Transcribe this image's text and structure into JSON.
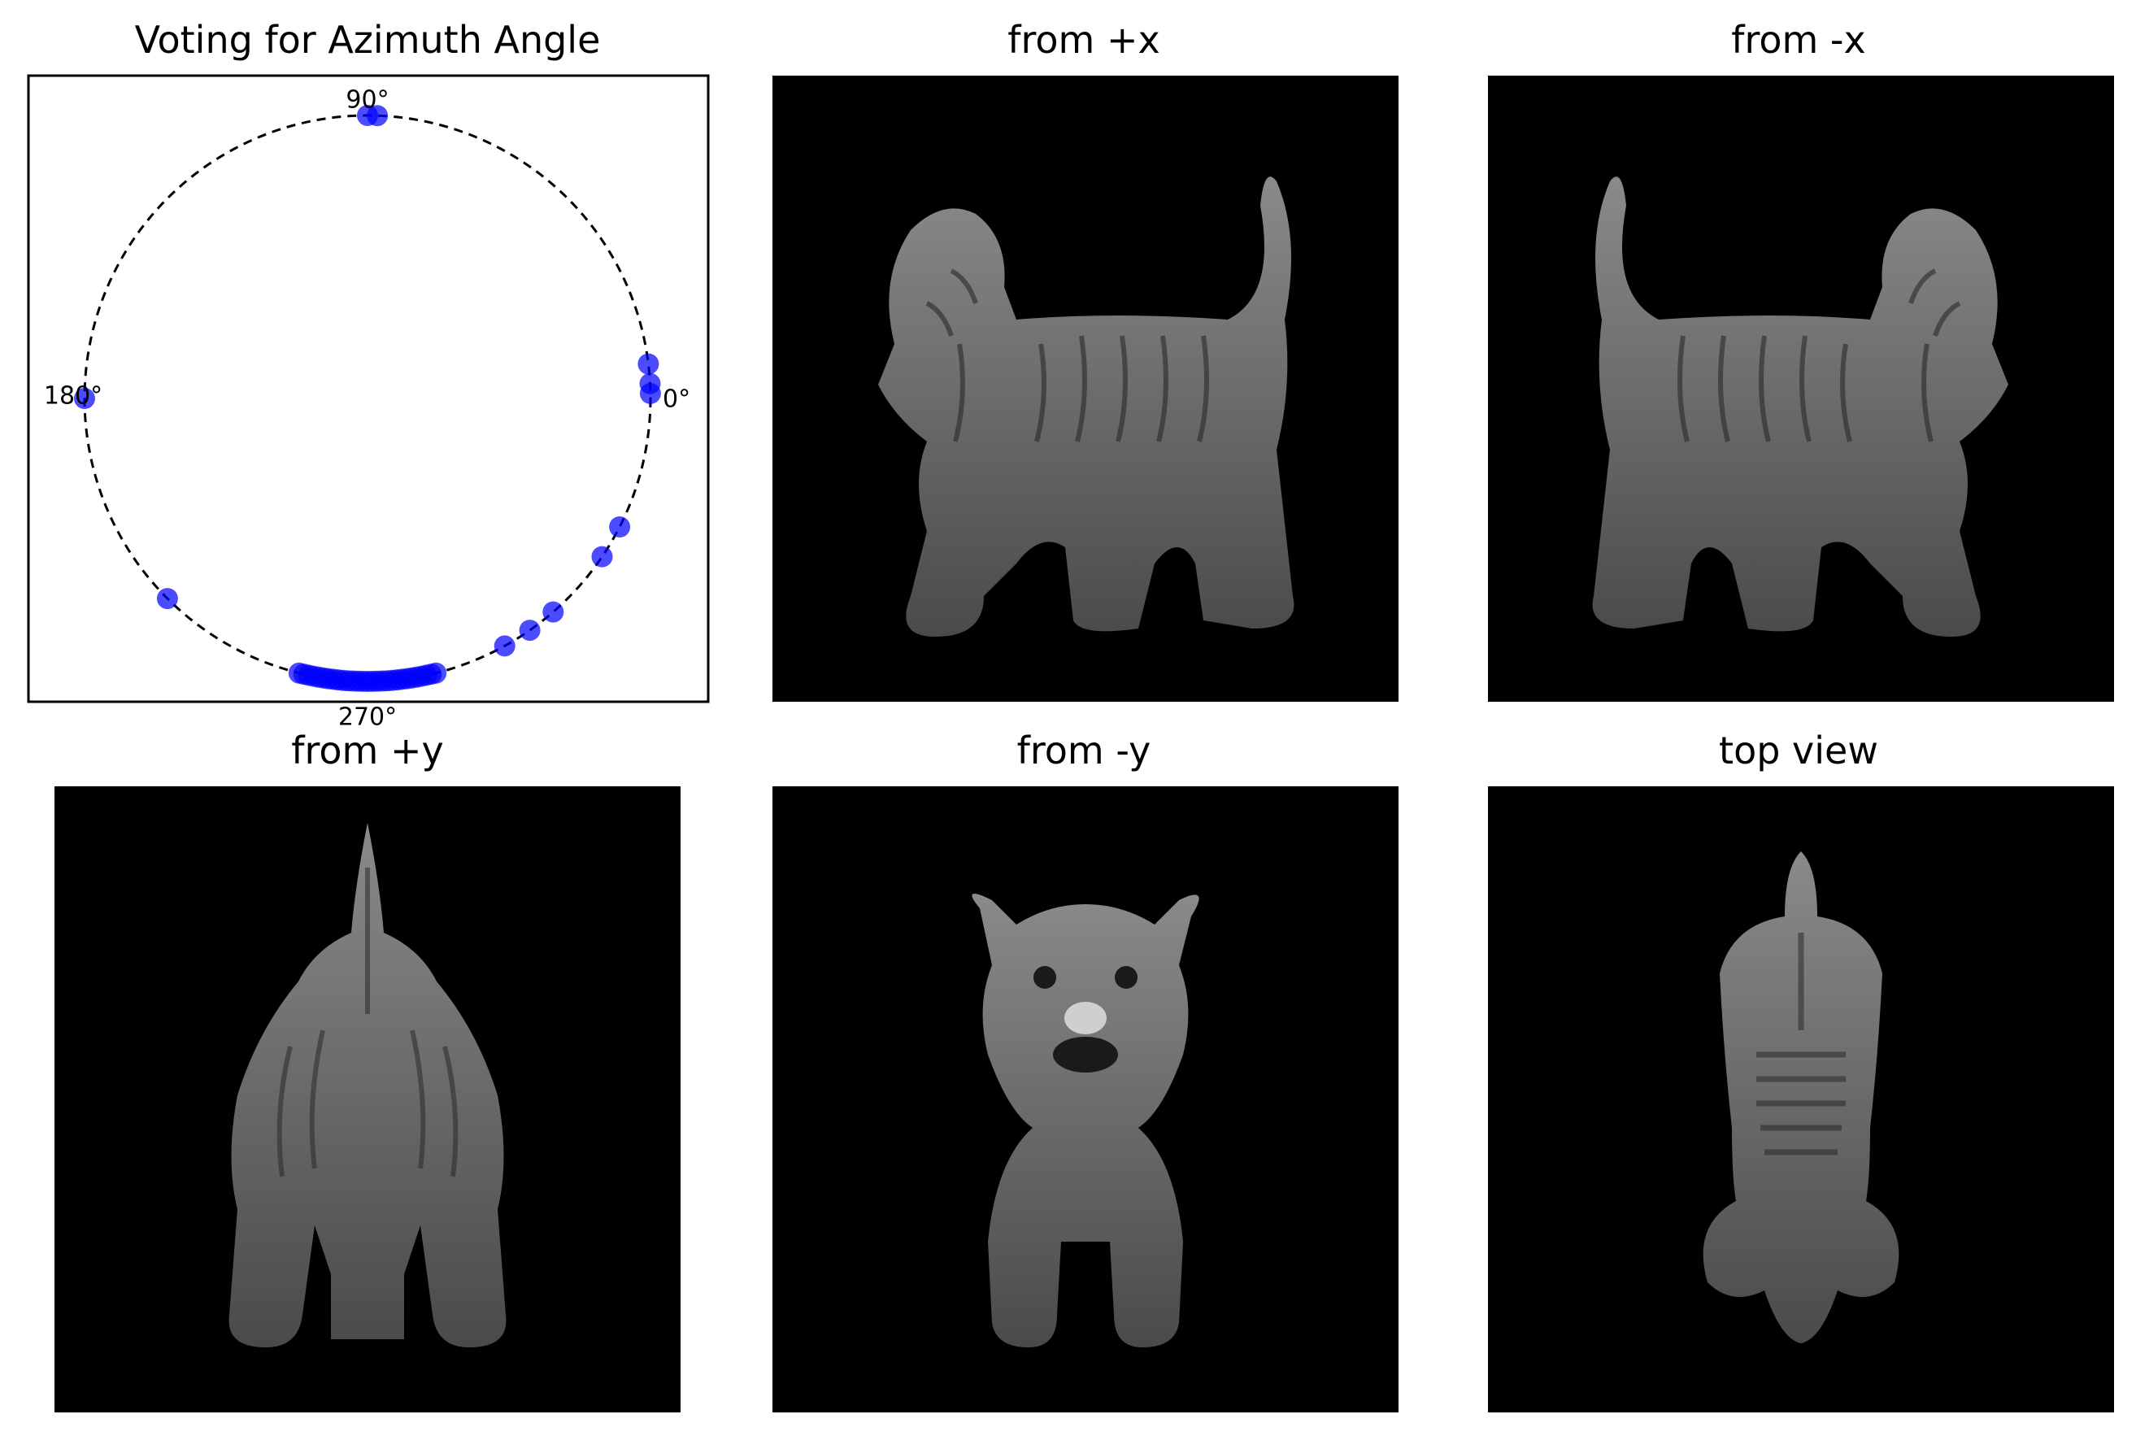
{
  "panels": {
    "vote": {
      "title": "Voting for Azimuth Angle"
    },
    "px": {
      "title": "from +x"
    },
    "nx": {
      "title": "from -x"
    },
    "py": {
      "title": "from +y"
    },
    "ny": {
      "title": "from -y"
    },
    "top": {
      "title": "top view"
    }
  },
  "colors": {
    "vote_point": "#0000ff",
    "circle": "#000000",
    "render_bg": "#000000",
    "figure_fill": "#6a6a6a"
  },
  "chart_data": {
    "type": "scatter",
    "title": "Voting for Azimuth Angle",
    "projection": "polar-azimuth",
    "angle_labels": [
      "0°",
      "90°",
      "180°",
      "270°"
    ],
    "xlim": [
      -1.1,
      1.1
    ],
    "ylim": [
      -1.1,
      1.1
    ],
    "grid": false,
    "ticks": false,
    "votes_deg": [
      1,
      3,
      7,
      88,
      90,
      180,
      225,
      256,
      257,
      258,
      259,
      260,
      261,
      262,
      263,
      264,
      265,
      266,
      267,
      268,
      269,
      270,
      271,
      272,
      273,
      274,
      275,
      276,
      277,
      278,
      279,
      280,
      281,
      282,
      283,
      284,
      299,
      305,
      311,
      326,
      333
    ]
  }
}
